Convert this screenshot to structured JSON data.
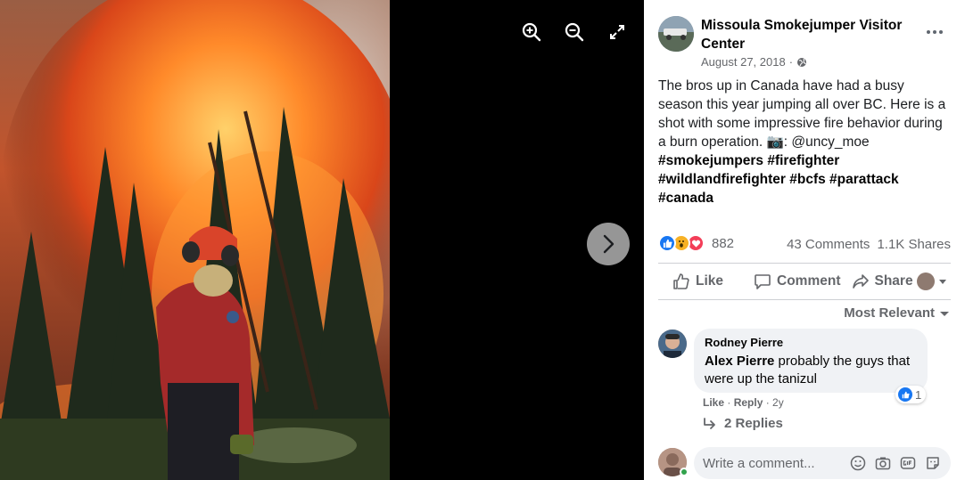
{
  "viewer": {
    "icons": [
      "zoom-in-icon",
      "zoom-out-icon",
      "fullscreen-icon",
      "chevron-right-icon"
    ]
  },
  "post": {
    "page_name": "Missoula Smokejumper Visitor Center",
    "date": "August 27, 2018",
    "privacy_separator": "·",
    "text_main": "The bros up in Canada have had a busy season this year jumping all over BC. Here is a shot with some impressive fire behavior during a burn operation. 📷: @uncy_moe",
    "hashtags": "#smokejumpers #firefighter #wildlandfirefighter #bcfs #parattack #canada",
    "reaction_count": "882",
    "comments_count": "43 Comments",
    "shares_count": "1.1K Shares",
    "colors": {
      "like": "#1877f2",
      "love": "#f33e58",
      "wow": "#f7b125"
    }
  },
  "actions": {
    "like": "Like",
    "comment": "Comment",
    "share": "Share"
  },
  "sort": {
    "label": "Most Relevant"
  },
  "comment": {
    "author": "Rodney Pierre",
    "mention": "Alex Pierre",
    "text": " probably the guys that were up the tanizul",
    "reaction_count": "1",
    "like": "Like",
    "reply": "Reply",
    "age": "2y",
    "sep": " · ",
    "replies": "2 Replies"
  },
  "composer": {
    "placeholder": "Write a comment..."
  }
}
